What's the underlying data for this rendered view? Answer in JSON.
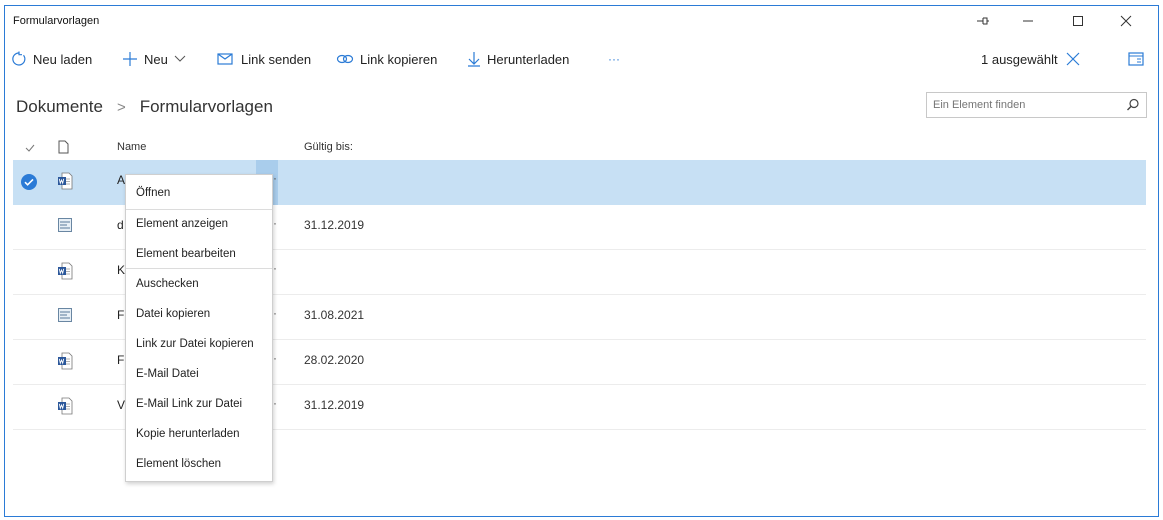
{
  "window": {
    "title": "Formularvorlagen"
  },
  "toolbar": {
    "reload": "Neu laden",
    "new": "Neu",
    "send_link": "Link senden",
    "copy_link": "Link kopieren",
    "download": "Herunterladen",
    "more": "···",
    "selection": "1 ausgewählt",
    "accent": "#2b7bd6"
  },
  "breadcrumb": {
    "root": "Dokumente",
    "separator": ">",
    "current": "Formularvorlagen"
  },
  "search": {
    "placeholder": "Ein Element finden"
  },
  "table": {
    "headers": {
      "name": "Name",
      "valid": "Gültig bis:"
    },
    "rows": [
      {
        "icon": "word-doc-icon",
        "name": "A",
        "dots": "·",
        "date": "",
        "selected": true
      },
      {
        "icon": "image-file-icon",
        "name": "d",
        "dots": "·",
        "date": "31.12.2019"
      },
      {
        "icon": "word-doc-icon",
        "name": "K",
        "dots": "·",
        "date": ""
      },
      {
        "icon": "image-file-icon",
        "name": "F",
        "dots": "·",
        "date": "31.08.2021"
      },
      {
        "icon": "word-doc-icon",
        "name": "F",
        "dots": "·",
        "date": "28.02.2020"
      },
      {
        "icon": "word-doc-icon",
        "name": "V",
        "dots": "·",
        "date": "31.12.2019"
      }
    ]
  },
  "context_menu": {
    "items": [
      "Öffnen",
      "Element anzeigen",
      "Element bearbeiten",
      "Auschecken",
      "Datei kopieren",
      "Link zur Datei kopieren",
      "E-Mail Datei",
      "E-Mail Link zur Datei",
      "Kopie herunterladen",
      "Element löschen"
    ]
  }
}
